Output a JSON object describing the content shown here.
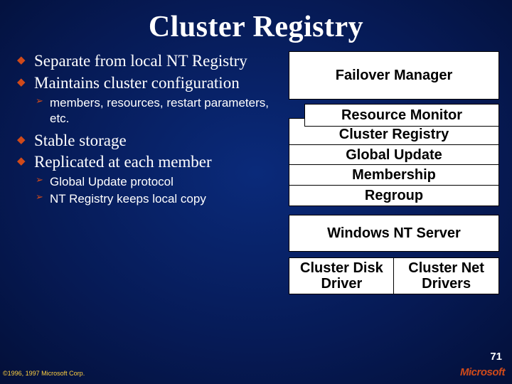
{
  "title": "Cluster Registry",
  "bullets": {
    "b0": "Separate from local NT Registry",
    "b1": "Maintains cluster configuration",
    "b1_sub0": "members, resources, restart parameters, etc.",
    "b2": "Stable storage",
    "b3": "Replicated at each member",
    "b3_sub0": "Global Update protocol",
    "b3_sub1": "NT Registry keeps local copy"
  },
  "diagram": {
    "failover": "Failover Manager",
    "resmon": "Resource Monitor",
    "clusreg": "Cluster Registry",
    "globup": "Global Update",
    "membership": "Membership",
    "regroup": "Regroup",
    "winnt": "Windows NT Server",
    "diskdrv": "Cluster Disk Driver",
    "netdrv": "Cluster Net Drivers"
  },
  "page_number": "71",
  "copyright": "©1996, 1997 Microsoft Corp.",
  "logo": "Microsoft"
}
